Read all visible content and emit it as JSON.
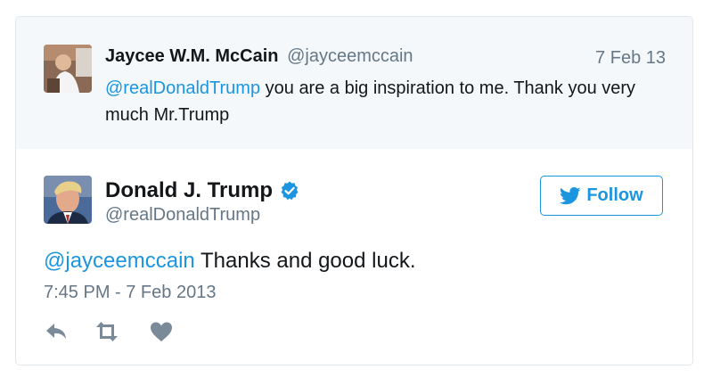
{
  "reply_context": {
    "author_name": "Jaycee W.M. McCain",
    "author_handle": "@jayceemccain",
    "date": "7 Feb 13",
    "mention": "@realDonaldTrump",
    "text": " you are a big inspiration to me. Thank you very much Mr.Trump"
  },
  "tweet": {
    "author_name": "Donald J. Trump",
    "author_handle": "@realDonaldTrump",
    "verified": true,
    "follow_label": "Follow",
    "mention": "@jayceemccain",
    "text": " Thanks and good luck.",
    "timestamp": "7:45 PM - 7 Feb 2013"
  },
  "actions": [
    {
      "name": "reply",
      "icon": "reply-icon"
    },
    {
      "name": "retweet",
      "icon": "retweet-icon"
    },
    {
      "name": "like",
      "icon": "heart-icon"
    }
  ],
  "colors": {
    "accent": "#1b95e0",
    "muted": "#657786",
    "text": "#14171a",
    "context_bg": "#f5f8fa",
    "border": "#e1e8ed"
  }
}
